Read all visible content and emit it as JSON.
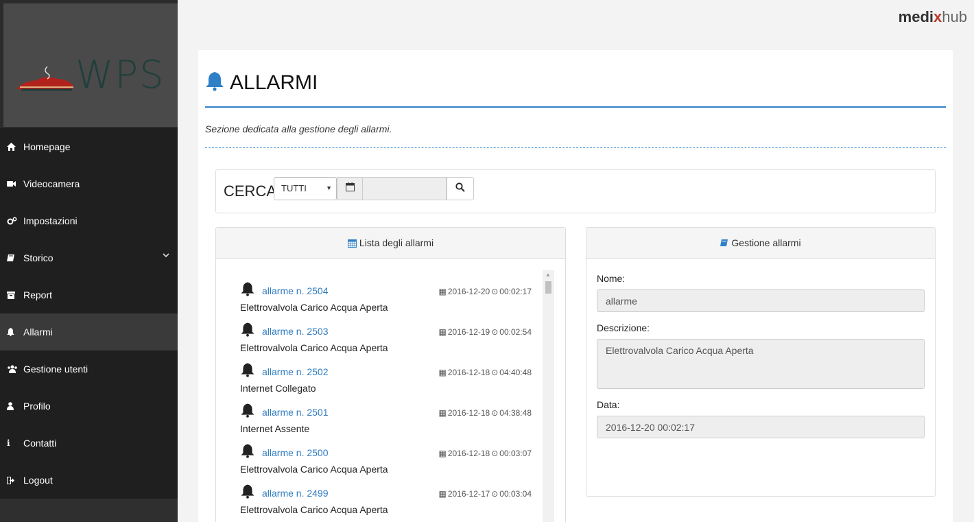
{
  "brand": {
    "part1": "medi",
    "part2": "x",
    "part3": "hub"
  },
  "logo": {
    "text": "WPS"
  },
  "nav": {
    "items": [
      {
        "label": "Homepage",
        "icon": "home-icon"
      },
      {
        "label": "Videocamera",
        "icon": "video-camera-icon"
      },
      {
        "label": "Impostazioni",
        "icon": "cogs-icon"
      },
      {
        "label": "Storico",
        "icon": "book-icon"
      },
      {
        "label": "Report",
        "icon": "archive-icon"
      },
      {
        "label": "Allarmi",
        "icon": "bell-icon"
      },
      {
        "label": "Gestione utenti",
        "icon": "users-icon"
      },
      {
        "label": "Profilo",
        "icon": "user-icon"
      },
      {
        "label": "Contatti",
        "icon": "info-icon"
      },
      {
        "label": "Logout",
        "icon": "sign-out-icon"
      }
    ],
    "active": "Allarmi"
  },
  "page": {
    "title": "ALLARMI",
    "subtitle": "Sezione dedicata alla gestione degli allarmi."
  },
  "search": {
    "label": "CERCA",
    "filter_value": "TUTTI",
    "date_value": ""
  },
  "list_panel": {
    "title": "Lista degli allarmi",
    "alarms": [
      {
        "name": "allarme n. 2504",
        "date": "2016-12-20",
        "time": "00:02:17",
        "description": "Elettrovalvola Carico Acqua Aperta"
      },
      {
        "name": "allarme n. 2503",
        "date": "2016-12-19",
        "time": "00:02:54",
        "description": "Elettrovalvola Carico Acqua Aperta"
      },
      {
        "name": "allarme n. 2502",
        "date": "2016-12-18",
        "time": "04:40:48",
        "description": "Internet Collegato"
      },
      {
        "name": "allarme n. 2501",
        "date": "2016-12-18",
        "time": "04:38:48",
        "description": "Internet Assente"
      },
      {
        "name": "allarme n. 2500",
        "date": "2016-12-18",
        "time": "00:03:07",
        "description": "Elettrovalvola Carico Acqua Aperta"
      },
      {
        "name": "allarme n. 2499",
        "date": "2016-12-17",
        "time": "00:03:04",
        "description": "Elettrovalvola Carico Acqua Aperta"
      }
    ]
  },
  "mgmt_panel": {
    "title": "Gestione allarmi",
    "nome_label": "Nome:",
    "nome_value": "allarme",
    "descrizione_label": "Descrizione:",
    "descrizione_value": "Elettrovalvola Carico Acqua Aperta",
    "data_label": "Data:",
    "data_value": "2016-12-20 00:02:17"
  },
  "colors": {
    "accent": "#2f80c7",
    "sidebar": "#1f1f1f",
    "link": "#2f7cc0"
  }
}
